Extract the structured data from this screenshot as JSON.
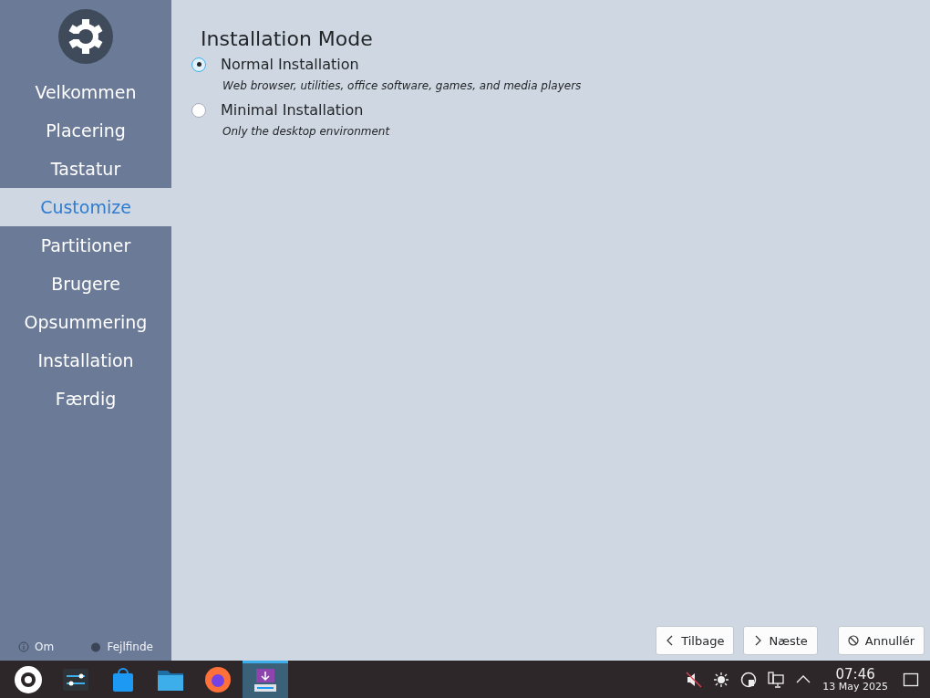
{
  "sidebar": {
    "steps": [
      {
        "label": "Velkommen",
        "selected": false
      },
      {
        "label": "Placering",
        "selected": false
      },
      {
        "label": "Tastatur",
        "selected": false
      },
      {
        "label": "Customize",
        "selected": true
      },
      {
        "label": "Partitioner",
        "selected": false
      },
      {
        "label": "Brugere",
        "selected": false
      },
      {
        "label": "Opsummering",
        "selected": false
      },
      {
        "label": "Installation",
        "selected": false
      },
      {
        "label": "Færdig",
        "selected": false
      }
    ],
    "footer": [
      {
        "kind": "about",
        "label": "Om"
      },
      {
        "kind": "debug",
        "label": "Fejlfinde"
      }
    ]
  },
  "content": {
    "title": "Installation Mode",
    "options": [
      {
        "label": "Normal Installation",
        "description": "Web browser, utilities, office software, games, and media players",
        "selected": true
      },
      {
        "label": "Minimal Installation",
        "description": "Only the desktop environment",
        "selected": false
      }
    ]
  },
  "buttons": [
    {
      "kind": "back",
      "label": "Tilbage"
    },
    {
      "kind": "next",
      "label": "Næste"
    },
    {
      "kind": "cancel",
      "label": "Annullér"
    }
  ],
  "taskbar": {
    "apps": [
      {
        "kind": "launcher",
        "selected": false
      },
      {
        "kind": "settings",
        "selected": false
      },
      {
        "kind": "store",
        "selected": false
      },
      {
        "kind": "files",
        "selected": false
      },
      {
        "kind": "browser",
        "selected": false
      },
      {
        "kind": "installer",
        "selected": true
      }
    ],
    "time": "07:46",
    "date": "13 May 2025"
  }
}
